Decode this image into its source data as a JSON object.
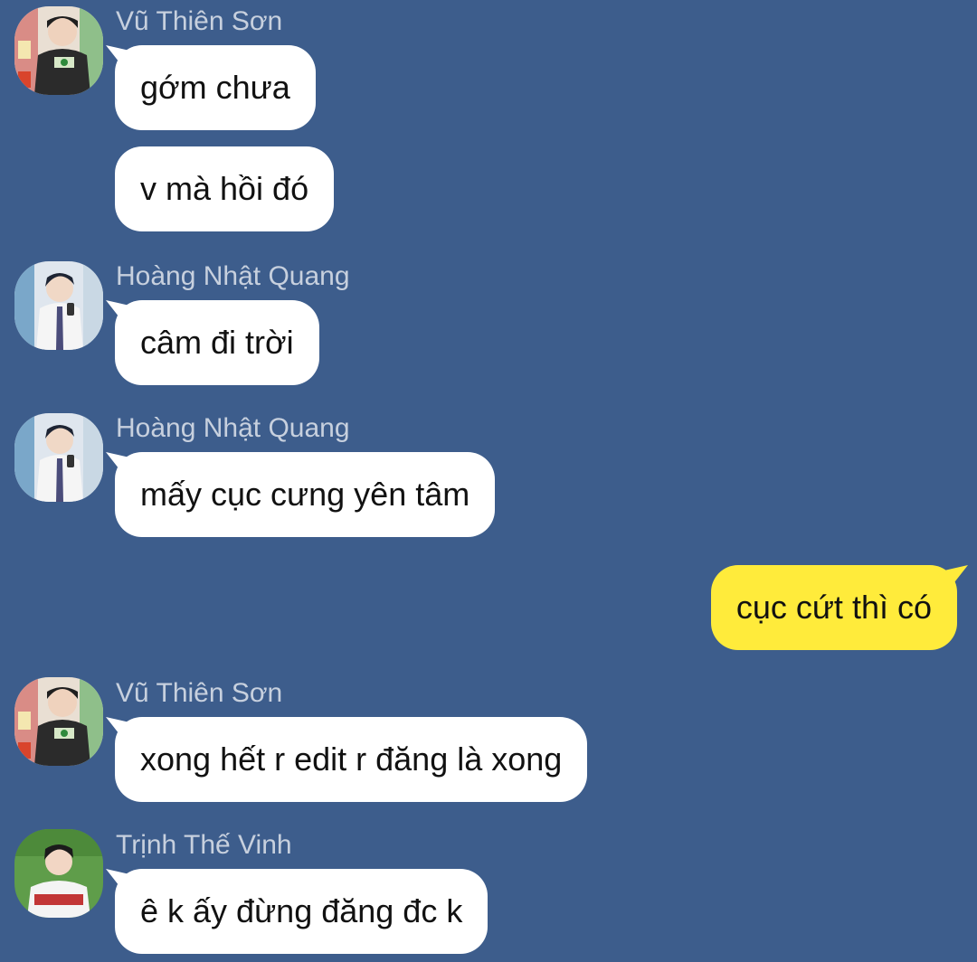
{
  "colors": {
    "background": "#3d5d8c",
    "incoming_bubble": "#ffffff",
    "outgoing_bubble": "#ffeb3b",
    "sender_name": "#c7d0de"
  },
  "messages": [
    {
      "sender": "Vũ Thiên Sơn",
      "text": "gớm chưa",
      "avatar": "avatar-son-icon"
    },
    {
      "text": "v mà hồi đó"
    },
    {
      "sender": "Hoàng Nhật Quang",
      "text": "câm đi trời",
      "avatar": "avatar-quang-icon"
    },
    {
      "sender": "Hoàng Nhật Quang",
      "text": "mấy cục cưng yên tâm",
      "avatar": "avatar-quang-icon"
    },
    {
      "text": "cục cứt thì có",
      "outgoing": true
    },
    {
      "sender": "Vũ Thiên Sơn",
      "text": "xong hết r edit r đăng là xong",
      "avatar": "avatar-son-icon"
    },
    {
      "sender": "Trịnh Thế Vinh",
      "text": "ê k ấy đừng đăng đc k",
      "avatar": "avatar-vinh-icon"
    }
  ]
}
